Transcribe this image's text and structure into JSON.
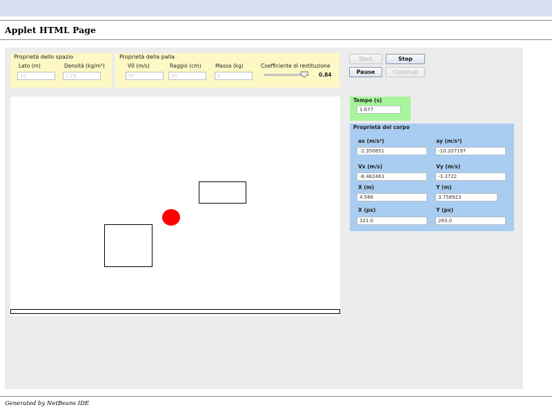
{
  "page": {
    "title": "Applet HTML Page",
    "footer": "Generated by NetBeans IDE"
  },
  "space_props": {
    "title": "Proprietà dello spazio",
    "lato_label": "Lato (m)",
    "lato_value": "10",
    "densita_label": "Densità (kg/m³)",
    "densita_value": "1.29"
  },
  "ball_props": {
    "title": "Proprietà della palla",
    "v0_label": "V0 (m/s)",
    "v0_value": "50",
    "raggio_label": "Raggio (cm)",
    "raggio_value": "20",
    "massa_label": "Massa (kg)",
    "massa_value": "1",
    "coeff_label": "Coefficiente di restituzione",
    "coeff_value": "0.84",
    "coeff_slider_level": 0.84
  },
  "controls": {
    "start": "Start",
    "stop": "Stop",
    "pause": "Pause",
    "continue": "Continue"
  },
  "tempo": {
    "label": "Tempo (s)",
    "value": "1.677"
  },
  "body_props": {
    "title": "Proprietà del corpo",
    "ax_label": "ax (m/s²)",
    "ax_value": "-2.350851",
    "ay_label": "ay (m/s²)",
    "ay_value": "-10.207197",
    "vx_label": "Vx (m/s)",
    "vx_value": "-8.482463",
    "vy_label": "Vy (m/s)",
    "vy_value": "-3.3722",
    "x_label": "X (m)",
    "x_value": "4.586",
    "y_label": "Y (m)",
    "y_value": "3.758923",
    "xpx_label": "X (px)",
    "xpx_value": "321.0",
    "ypx_label": "Y (px)",
    "ypx_value": "263.0"
  },
  "colors": {
    "ball": "#ff0000",
    "tempo_panel": "#a6f59a",
    "body_panel": "#a9cdf0",
    "props_panel": "#fdf8c4",
    "applet_bg": "#ececec"
  }
}
